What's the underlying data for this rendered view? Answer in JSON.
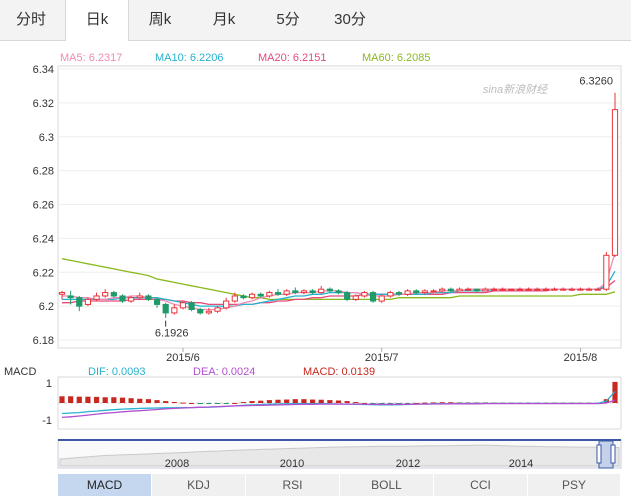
{
  "tabs": [
    {
      "label": "分时",
      "active": false
    },
    {
      "label": "日k",
      "active": true
    },
    {
      "label": "周k",
      "active": false
    },
    {
      "label": "月k",
      "active": false
    },
    {
      "label": "5分",
      "active": false
    },
    {
      "label": "30分",
      "active": false
    }
  ],
  "watermark": "sina新浪财经",
  "legend": [
    {
      "label": "MA5: 6.2317",
      "color": "#f08bb5"
    },
    {
      "label": "MA10: 6.2206",
      "color": "#27b2cf"
    },
    {
      "label": "MA20: 6.2151",
      "color": "#e64b7a"
    },
    {
      "label": "MA60: 6.2085",
      "color": "#8bb91d"
    }
  ],
  "colors": {
    "up": "#e8353a",
    "down": "#1f9b6a",
    "ma5": "#f08bb5",
    "ma10": "#27b2cf",
    "ma20": "#e64b7a",
    "ma60": "#8bb91d",
    "dif": "#27b2cf",
    "dea": "#b34fd1",
    "macd": "#c8281f",
    "navigator": "#3b5aa6"
  },
  "chart_data": {
    "type": "candlestick",
    "y_ticks": [
      "6.34",
      "6.32",
      "6.3",
      "6.28",
      "6.26",
      "6.24",
      "6.22",
      "6.2",
      "6.18"
    ],
    "ylim": [
      6.18,
      6.34
    ],
    "x_ticks": [
      {
        "label": "2015/6",
        "index": 14
      },
      {
        "label": "2015/7",
        "index": 37
      },
      {
        "label": "2015/8",
        "index": 60
      }
    ],
    "annotations": [
      {
        "label": "6.3260",
        "index": 64,
        "value": 6.326
      },
      {
        "label": "6.1926",
        "index": 12,
        "value": 6.1926
      }
    ],
    "candles": [
      [
        6.207,
        6.208,
        6.209,
        6.204
      ],
      [
        6.206,
        6.205,
        6.209,
        6.201
      ],
      [
        6.205,
        6.2,
        6.206,
        6.197
      ],
      [
        6.201,
        6.204,
        6.205,
        6.2
      ],
      [
        6.204,
        6.206,
        6.208,
        6.203
      ],
      [
        6.206,
        6.208,
        6.21,
        6.205
      ],
      [
        6.208,
        6.206,
        6.209,
        6.205
      ],
      [
        6.206,
        6.203,
        6.207,
        6.202
      ],
      [
        6.203,
        6.205,
        6.206,
        6.202
      ],
      [
        6.205,
        6.206,
        6.208,
        6.204
      ],
      [
        6.206,
        6.204,
        6.207,
        6.203
      ],
      [
        6.204,
        6.201,
        6.205,
        6.199
      ],
      [
        6.201,
        6.196,
        6.202,
        6.193
      ],
      [
        6.196,
        6.199,
        6.201,
        6.195
      ],
      [
        6.199,
        6.202,
        6.203,
        6.198
      ],
      [
        6.202,
        6.198,
        6.203,
        6.197
      ],
      [
        6.198,
        6.196,
        6.199,
        6.195
      ],
      [
        6.196,
        6.197,
        6.199,
        6.195
      ],
      [
        6.197,
        6.199,
        6.2,
        6.196
      ],
      [
        6.199,
        6.203,
        6.205,
        6.198
      ],
      [
        6.203,
        6.206,
        6.208,
        6.202
      ],
      [
        6.206,
        6.205,
        6.207,
        6.204
      ],
      [
        6.205,
        6.207,
        6.208,
        6.204
      ],
      [
        6.207,
        6.206,
        6.208,
        6.205
      ],
      [
        6.206,
        6.208,
        6.209,
        6.205
      ],
      [
        6.208,
        6.207,
        6.21,
        6.206
      ],
      [
        6.207,
        6.209,
        6.21,
        6.206
      ],
      [
        6.209,
        6.208,
        6.211,
        6.207
      ],
      [
        6.208,
        6.209,
        6.21,
        6.207
      ],
      [
        6.209,
        6.208,
        6.21,
        6.207
      ],
      [
        6.208,
        6.21,
        6.212,
        6.207
      ],
      [
        6.21,
        6.209,
        6.211,
        6.208
      ],
      [
        6.209,
        6.208,
        6.21,
        6.207
      ],
      [
        6.208,
        6.204,
        6.209,
        6.203
      ],
      [
        6.204,
        6.206,
        6.207,
        6.203
      ],
      [
        6.206,
        6.208,
        6.209,
        6.205
      ],
      [
        6.208,
        6.203,
        6.209,
        6.202
      ],
      [
        6.203,
        6.206,
        6.207,
        6.202
      ],
      [
        6.206,
        6.208,
        6.209,
        6.205
      ],
      [
        6.208,
        6.207,
        6.209,
        6.206
      ],
      [
        6.207,
        6.209,
        6.21,
        6.206
      ],
      [
        6.209,
        6.208,
        6.21,
        6.207
      ],
      [
        6.208,
        6.209,
        6.21,
        6.207
      ],
      [
        6.209,
        6.209,
        6.21,
        6.208
      ],
      [
        6.209,
        6.21,
        6.211,
        6.208
      ],
      [
        6.21,
        6.209,
        6.211,
        6.208
      ],
      [
        6.209,
        6.21,
        6.211,
        6.209
      ],
      [
        6.21,
        6.21,
        6.211,
        6.209
      ],
      [
        6.21,
        6.209,
        6.21,
        6.208
      ],
      [
        6.209,
        6.21,
        6.211,
        6.209
      ],
      [
        6.21,
        6.21,
        6.211,
        6.209
      ],
      [
        6.21,
        6.21,
        6.211,
        6.209
      ],
      [
        6.21,
        6.21,
        6.21,
        6.209
      ],
      [
        6.21,
        6.21,
        6.211,
        6.209
      ],
      [
        6.21,
        6.21,
        6.211,
        6.21
      ],
      [
        6.21,
        6.21,
        6.211,
        6.209
      ],
      [
        6.21,
        6.21,
        6.211,
        6.21
      ],
      [
        6.21,
        6.21,
        6.211,
        6.21
      ],
      [
        6.21,
        6.21,
        6.211,
        6.21
      ],
      [
        6.21,
        6.21,
        6.211,
        6.209
      ],
      [
        6.21,
        6.21,
        6.211,
        6.21
      ],
      [
        6.21,
        6.21,
        6.211,
        6.21
      ],
      [
        6.21,
        6.21,
        6.211,
        6.21
      ],
      [
        6.21,
        6.23,
        6.232,
        6.209
      ],
      [
        6.23,
        6.316,
        6.326,
        6.229
      ]
    ],
    "ma5": [
      6.206,
      6.206,
      6.205,
      6.205,
      6.204,
      6.204,
      6.205,
      6.205,
      6.206,
      6.206,
      6.205,
      6.204,
      6.203,
      6.201,
      6.2,
      6.199,
      6.198,
      6.198,
      6.198,
      6.199,
      6.2,
      6.202,
      6.203,
      6.205,
      6.206,
      6.207,
      6.207,
      6.208,
      6.208,
      6.208,
      6.209,
      6.209,
      6.209,
      6.208,
      6.208,
      6.207,
      6.206,
      6.206,
      6.206,
      6.207,
      6.207,
      6.208,
      6.208,
      6.208,
      6.209,
      6.209,
      6.209,
      6.21,
      6.21,
      6.21,
      6.21,
      6.21,
      6.21,
      6.21,
      6.21,
      6.21,
      6.21,
      6.21,
      6.21,
      6.21,
      6.21,
      6.21,
      6.21,
      6.214,
      6.2317
    ],
    "ma10": [
      6.204,
      6.204,
      6.204,
      6.204,
      6.204,
      6.204,
      6.204,
      6.205,
      6.205,
      6.205,
      6.205,
      6.205,
      6.204,
      6.203,
      6.202,
      6.201,
      6.2,
      6.2,
      6.2,
      6.2,
      6.2,
      6.201,
      6.201,
      6.202,
      6.203,
      6.204,
      6.205,
      6.206,
      6.206,
      6.207,
      6.207,
      6.208,
      6.208,
      6.208,
      6.208,
      6.207,
      6.207,
      6.207,
      6.207,
      6.207,
      6.207,
      6.207,
      6.207,
      6.208,
      6.208,
      6.208,
      6.209,
      6.209,
      6.209,
      6.209,
      6.21,
      6.21,
      6.21,
      6.21,
      6.21,
      6.21,
      6.21,
      6.21,
      6.21,
      6.21,
      6.21,
      6.21,
      6.21,
      6.212,
      6.2206
    ],
    "ma20": [
      6.202,
      6.202,
      6.203,
      6.203,
      6.203,
      6.203,
      6.203,
      6.203,
      6.204,
      6.204,
      6.204,
      6.204,
      6.204,
      6.203,
      6.203,
      6.202,
      6.202,
      6.201,
      6.201,
      6.201,
      6.201,
      6.201,
      6.201,
      6.202,
      6.202,
      6.203,
      6.203,
      6.204,
      6.204,
      6.205,
      6.205,
      6.206,
      6.206,
      6.206,
      6.206,
      6.207,
      6.207,
      6.207,
      6.207,
      6.207,
      6.207,
      6.207,
      6.207,
      6.207,
      6.207,
      6.208,
      6.208,
      6.208,
      6.208,
      6.208,
      6.209,
      6.209,
      6.209,
      6.209,
      6.209,
      6.209,
      6.209,
      6.21,
      6.21,
      6.21,
      6.21,
      6.21,
      6.21,
      6.211,
      6.2151
    ],
    "ma60": [
      6.228,
      6.227,
      6.226,
      6.225,
      6.224,
      6.223,
      6.222,
      6.221,
      6.22,
      6.219,
      6.218,
      6.216,
      6.215,
      6.214,
      6.213,
      6.212,
      6.211,
      6.21,
      6.209,
      6.208,
      6.207,
      6.206,
      6.205,
      6.205,
      6.204,
      6.204,
      6.204,
      6.204,
      6.204,
      6.204,
      6.204,
      6.204,
      6.204,
      6.204,
      6.204,
      6.204,
      6.204,
      6.204,
      6.204,
      6.205,
      6.205,
      6.205,
      6.205,
      6.205,
      6.205,
      6.205,
      6.206,
      6.206,
      6.206,
      6.206,
      6.206,
      6.206,
      6.206,
      6.206,
      6.206,
      6.206,
      6.206,
      6.206,
      6.206,
      6.206,
      6.207,
      6.207,
      6.207,
      6.207,
      6.2085
    ],
    "macd_panel": {
      "label": "MACD",
      "legend": [
        {
          "label": "DIF: 0.0093",
          "color": "#27b2cf"
        },
        {
          "label": "DEA: 0.0024",
          "color": "#b34fd1"
        },
        {
          "label": "MACD: 0.0139",
          "color": "#c8281f"
        }
      ],
      "y_ticks": [
        "1",
        "-1"
      ],
      "ylim": [
        -1.2,
        1.2
      ],
      "macd": [
        0.35,
        0.35,
        0.33,
        0.33,
        0.32,
        0.3,
        0.3,
        0.28,
        0.25,
        0.22,
        0.2,
        0.15,
        0.1,
        0.05,
        0.02,
        0.0,
        -0.02,
        -0.02,
        -0.03,
        -0.02,
        0.0,
        0.05,
        0.1,
        0.12,
        0.15,
        0.17,
        0.18,
        0.2,
        0.2,
        0.18,
        0.17,
        0.15,
        0.13,
        0.1,
        0.05,
        0.0,
        -0.05,
        -0.08,
        -0.1,
        -0.08,
        -0.05,
        0.0,
        0.02,
        0.03,
        0.04,
        0.04,
        0.03,
        0.03,
        0.03,
        0.03,
        0.02,
        0.02,
        0.02,
        0.02,
        0.02,
        0.02,
        0.02,
        0.02,
        0.02,
        0.02,
        0.02,
        0.02,
        0.02,
        0.2,
        1.1
      ],
      "dif": [
        -0.55,
        -0.52,
        -0.5,
        -0.45,
        -0.42,
        -0.38,
        -0.35,
        -0.32,
        -0.3,
        -0.28,
        -0.27,
        -0.26,
        -0.25,
        -0.25,
        -0.24,
        -0.24,
        -0.23,
        -0.22,
        -0.2,
        -0.18,
        -0.15,
        -0.12,
        -0.1,
        -0.08,
        -0.06,
        -0.05,
        -0.04,
        -0.03,
        -0.03,
        -0.03,
        -0.03,
        -0.04,
        -0.05,
        -0.06,
        -0.07,
        -0.08,
        -0.09,
        -0.1,
        -0.1,
        -0.09,
        -0.08,
        -0.06,
        -0.05,
        -0.04,
        -0.03,
        -0.03,
        -0.02,
        -0.02,
        -0.02,
        -0.02,
        -0.02,
        -0.02,
        -0.02,
        -0.02,
        -0.02,
        -0.02,
        -0.02,
        -0.02,
        -0.02,
        -0.02,
        -0.02,
        -0.02,
        -0.02,
        0.1,
        0.6
      ],
      "dea": [
        -0.75,
        -0.72,
        -0.68,
        -0.63,
        -0.58,
        -0.53,
        -0.5,
        -0.46,
        -0.43,
        -0.4,
        -0.37,
        -0.34,
        -0.31,
        -0.28,
        -0.26,
        -0.24,
        -0.22,
        -0.21,
        -0.19,
        -0.17,
        -0.15,
        -0.14,
        -0.13,
        -0.12,
        -0.11,
        -0.1,
        -0.09,
        -0.08,
        -0.07,
        -0.07,
        -0.06,
        -0.06,
        -0.06,
        -0.06,
        -0.06,
        -0.06,
        -0.07,
        -0.07,
        -0.07,
        -0.07,
        -0.07,
        -0.06,
        -0.06,
        -0.05,
        -0.05,
        -0.04,
        -0.04,
        -0.04,
        -0.04,
        -0.03,
        -0.03,
        -0.03,
        -0.03,
        -0.03,
        -0.03,
        -0.03,
        -0.03,
        -0.03,
        -0.03,
        -0.03,
        -0.03,
        -0.03,
        -0.03,
        0.0,
        0.15
      ]
    },
    "navigator": {
      "x_ticks": [
        "2008",
        "2010",
        "2012",
        "2014"
      ],
      "series": [
        0.3,
        0.35,
        0.4,
        0.45,
        0.48,
        0.5,
        0.52,
        0.55,
        0.57,
        0.6,
        0.63,
        0.65,
        0.68,
        0.7,
        0.72,
        0.74,
        0.76,
        0.78,
        0.8,
        0.82,
        0.83,
        0.84,
        0.85,
        0.86,
        0.86,
        0.87,
        0.88,
        0.88,
        0.89,
        0.9,
        0.9,
        0.88,
        0.86,
        0.85,
        0.84,
        0.83,
        0.82,
        0.82,
        0.81,
        0.8
      ]
    }
  },
  "bottom_tabs": [
    {
      "label": "MACD",
      "active": true
    },
    {
      "label": "KDJ",
      "active": false
    },
    {
      "label": "RSI",
      "active": false
    },
    {
      "label": "BOLL",
      "active": false
    },
    {
      "label": "CCI",
      "active": false
    },
    {
      "label": "PSY",
      "active": false
    }
  ]
}
